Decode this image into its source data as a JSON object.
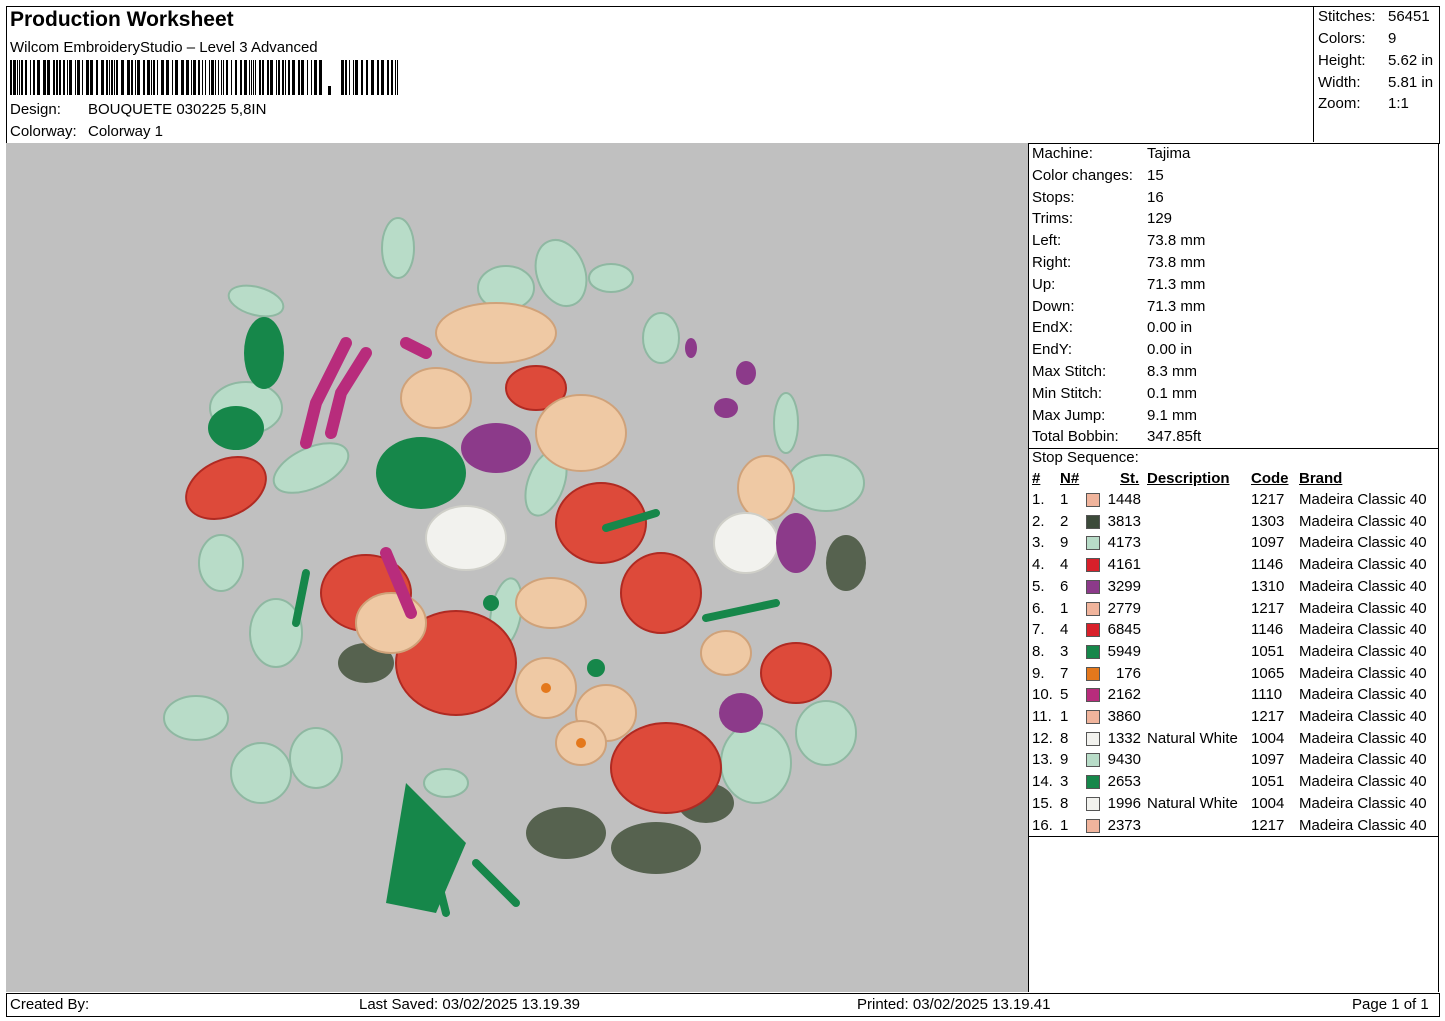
{
  "header": {
    "title": "Production Worksheet",
    "software": "Wilcom EmbroideryStudio – Level 3 Advanced",
    "design_label": "Design:",
    "design_value": "BOUQUETE 030225 5,8IN",
    "colorway_label": "Colorway:",
    "colorway_value": "Colorway 1"
  },
  "stats": [
    {
      "label": "Stitches:",
      "value": "56451"
    },
    {
      "label": "Colors:",
      "value": "9"
    },
    {
      "label": "Height:",
      "value": "5.62 in"
    },
    {
      "label": "Width:",
      "value": "5.81 in"
    },
    {
      "label": "Zoom:",
      "value": "1:1"
    }
  ],
  "machine_info": [
    {
      "label": "Machine:",
      "value": "Tajima"
    },
    {
      "label": "Color changes:",
      "value": "15"
    },
    {
      "label": "Stops:",
      "value": "16"
    },
    {
      "label": "Trims:",
      "value": "129"
    },
    {
      "label": "Left:",
      "value": "73.8 mm"
    },
    {
      "label": "Right:",
      "value": "73.8 mm"
    },
    {
      "label": "Up:",
      "value": "71.3 mm"
    },
    {
      "label": "Down:",
      "value": "71.3 mm"
    },
    {
      "label": "EndX:",
      "value": "0.00 in"
    },
    {
      "label": "EndY:",
      "value": "0.00 in"
    },
    {
      "label": "Max Stitch:",
      "value": "8.3 mm"
    },
    {
      "label": "Min Stitch:",
      "value": "0.1 mm"
    },
    {
      "label": "Max Jump:",
      "value": "9.1 mm"
    },
    {
      "label": "Total Bobbin:",
      "value": "347.85ft"
    }
  ],
  "stop_sequence": {
    "title": "Stop Sequence:",
    "columns": [
      "#",
      "N#",
      "St.",
      "Description",
      "Code",
      "Brand"
    ],
    "rows": [
      {
        "idx": "1.",
        "n": "1",
        "color": "#f0b49c",
        "st": "1448",
        "desc": "",
        "code": "1217",
        "brand": "Madeira Classic 40"
      },
      {
        "idx": "2.",
        "n": "2",
        "color": "#3c4a3a",
        "st": "3813",
        "desc": "",
        "code": "1303",
        "brand": "Madeira Classic 40"
      },
      {
        "idx": "3.",
        "n": "9",
        "color": "#b8dcc8",
        "st": "4173",
        "desc": "",
        "code": "1097",
        "brand": "Madeira Classic 40"
      },
      {
        "idx": "4.",
        "n": "4",
        "color": "#d8202a",
        "st": "4161",
        "desc": "",
        "code": "1146",
        "brand": "Madeira Classic 40"
      },
      {
        "idx": "5.",
        "n": "6",
        "color": "#8c3a8a",
        "st": "3299",
        "desc": "",
        "code": "1310",
        "brand": "Madeira Classic 40"
      },
      {
        "idx": "6.",
        "n": "1",
        "color": "#f0b49c",
        "st": "2779",
        "desc": "",
        "code": "1217",
        "brand": "Madeira Classic 40"
      },
      {
        "idx": "7.",
        "n": "4",
        "color": "#d8202a",
        "st": "6845",
        "desc": "",
        "code": "1146",
        "brand": "Madeira Classic 40"
      },
      {
        "idx": "8.",
        "n": "3",
        "color": "#16874a",
        "st": "5949",
        "desc": "",
        "code": "1051",
        "brand": "Madeira Classic 40"
      },
      {
        "idx": "9.",
        "n": "7",
        "color": "#e4781c",
        "st": "176",
        "desc": "",
        "code": "1065",
        "brand": "Madeira Classic 40"
      },
      {
        "idx": "10.",
        "n": "5",
        "color": "#b82c7c",
        "st": "2162",
        "desc": "",
        "code": "1110",
        "brand": "Madeira Classic 40"
      },
      {
        "idx": "11.",
        "n": "1",
        "color": "#f0b49c",
        "st": "3860",
        "desc": "",
        "code": "1217",
        "brand": "Madeira Classic 40"
      },
      {
        "idx": "12.",
        "n": "8",
        "color": "#f2f2ee",
        "st": "1332",
        "desc": "Natural White",
        "code": "1004",
        "brand": "Madeira Classic 40"
      },
      {
        "idx": "13.",
        "n": "9",
        "color": "#b8dcc8",
        "st": "9430",
        "desc": "",
        "code": "1097",
        "brand": "Madeira Classic 40"
      },
      {
        "idx": "14.",
        "n": "3",
        "color": "#16874a",
        "st": "2653",
        "desc": "",
        "code": "1051",
        "brand": "Madeira Classic 40"
      },
      {
        "idx": "15.",
        "n": "8",
        "color": "#f2f2ee",
        "st": "1996",
        "desc": "Natural White",
        "code": "1004",
        "brand": "Madeira Classic 40"
      },
      {
        "idx": "16.",
        "n": "1",
        "color": "#f0b49c",
        "st": "2373",
        "desc": "",
        "code": "1217",
        "brand": "Madeira Classic 40"
      }
    ]
  },
  "footer": {
    "created_by": "Created By:",
    "last_saved": "Last Saved: 03/02/2025 13.19.39",
    "printed": "Printed: 03/02/2025 13.19.41",
    "page": "Page 1 of 1"
  }
}
